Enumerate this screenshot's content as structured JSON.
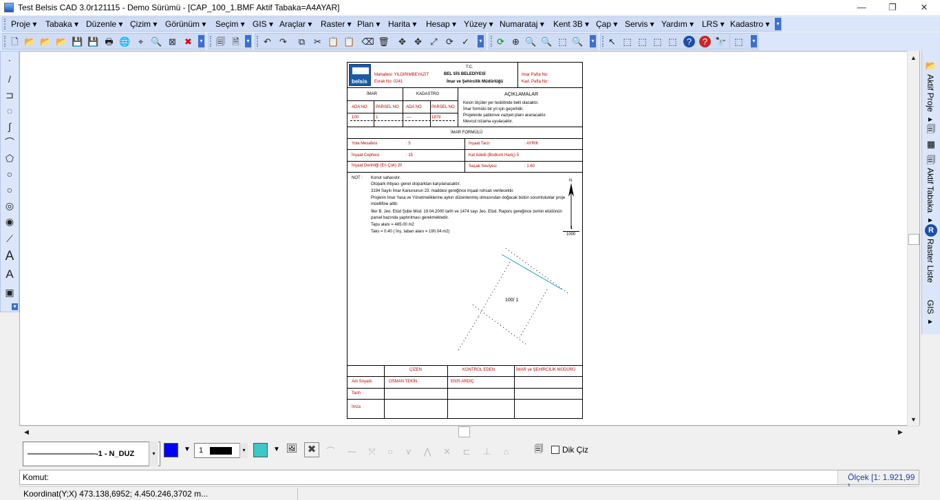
{
  "window": {
    "title": "Test Belsis CAD 3.0r121115 - Demo Sürümü - [CAP_100_1.BMF  Aktif Tabaka=A4AYAR]",
    "minimize": "—",
    "maximize": "❐",
    "close": "✕"
  },
  "menu": [
    "Proje ▾",
    "Tabaka ▾",
    "Düzenle ▾",
    "Çizim ▾",
    "Görünüm ▾",
    "Seçim ▾",
    "GIS ▾",
    "Araçlar ▾",
    "Raster ▾",
    "Plan ▾",
    "Harita ▾",
    "Hesap ▾",
    "Yüzey ▾",
    "Numarataj ▾",
    "Kent 3B ▾",
    "Çap ▾",
    "Servis ▾",
    "Yardım ▾",
    "LRS ▾",
    "Kadastro ▾"
  ],
  "toolbar_glyphs": [
    "🗋",
    "📂",
    "📂",
    "📂",
    "💾",
    "💾",
    "🖶",
    "🌐",
    "⌖",
    "🔍",
    "⊠",
    "✖",
    "🗐",
    "🗎",
    "↶",
    "↷",
    "⧉",
    "✂",
    "📋",
    "📋",
    "⌫",
    "🗑",
    "✥",
    "✥",
    "⤢",
    "⟳",
    "✓",
    "⟳",
    "⊕",
    "🔍",
    "🔍",
    "⬚",
    "🔍",
    "↖",
    "⬚",
    "⬚",
    "⬚",
    "⬚",
    "?",
    "?",
    "🔭",
    "⬚"
  ],
  "left_tools": [
    "·",
    "/",
    "⊐",
    "◌",
    "∫",
    "⌒",
    "⬠",
    "○",
    "○",
    "◎",
    "◉",
    "⟋",
    "A",
    "A",
    "▣"
  ],
  "right_panel": {
    "aktif_proje": "Aktif Proje ▸",
    "aktif_tabaka": "Aktif Tabaka ▸",
    "raster_liste": "Raster Liste",
    "gis": "GIS ▸"
  },
  "bottom": {
    "linetype": "—————————-1 - N_DUZ",
    "lineweight": "1",
    "color": "#0000ff",
    "fill": "#3cc8c8",
    "dik_ciz": "Dik Çiz"
  },
  "command": {
    "label": "Komut:",
    "value": ""
  },
  "scale": "Ölçek [1: 1.921,99 ]",
  "coords": "Koordinat(Y;X)  473.138,6952; 4.450.246,3702 m...",
  "doc": {
    "logo": "belsis",
    "mahallesi": "Mahallesi:  YILDIRIMBEYAZIT",
    "evrak": "Evrak No:  0241",
    "tc": "T.C.",
    "belediye": "BEL SİS BELEDİYESİ",
    "mudurluk": "İmar ve Şehircilik Müdürlüğü",
    "imar_pafta": "İmar Pafta No:",
    "kad_pafta": "Kad. Pafta No:",
    "imar": "İMAR",
    "kadastro": "KADASTRO",
    "aciklamalar": "AÇIKLAMALAR",
    "ada_no": "ADA NO",
    "parsel_no": "PARSEL NO",
    "v_ada": "100",
    "v_parsel": "1",
    "v_kada": "----",
    "v_kparsel": "1879",
    "aciklama": [
      "Kesin ölçüler yer tesbitinde belli olacaktır.",
      "İmar formülü bir yıl için geçerlidir.",
      "Projelerde şablonve vaziyet planı aranacaktır.",
      "Mevcut nizama uyulacaktır."
    ],
    "imar_formulu": "İMAR FORMÜLÜ",
    "yola": "Yola Mesafesi",
    "yola_v": ": 5",
    "insaat_tarzi": "İnşaat Tarzı",
    "insaat_tarzi_v": ": AYRIK",
    "cephe": "İnşaat Cephesi",
    "cephe_v": ": 15",
    "kat": "Kat Adedi (Bodrum Hariç) 5",
    "derinlik": "İnşaat Derinliği (En Çok) 20",
    "sacak": "Saçak Seviyesi",
    "sacak_v": ": 1.60",
    "not_label": "NOT :",
    "notes": [
      "Konut sahasıdır.",
      "Otopark ihtiyacı genel otoparktan karşılanacaktır.",
      "3194 Sayılı İmar Kanununun 23. maddesi gereğince inşaat ruhsatı verilecektir.",
      "Projenin İmar Yasa ve Yönetmeliklerine aykırı düzenlenmiş olmasından doğacak bütün sorumluluklar proje müellifine aittir.",
      "İller B. Jeo. Etüd Şube Müd. 19.04.2000 tarih ve 1474 sayı Jeo. Etüd. Raporu gereğince zemin etüdünün parsel bazında yaptırılması gerekmektedir.",
      "Tapu alanı = 485.00 m2",
      "Taks = 0.40 ( İnş. taban alanı = 190.04 m2)"
    ],
    "north": "N",
    "scale_num": "1",
    "scale_den": "1000",
    "parcel": "100/ 1",
    "cizen": "ÇİZEN",
    "kontrol": "KONTROL EDEN",
    "imar_mudur": "İMAR ve ŞEHİRCİLİK MÜDÜRÜ",
    "adi": "Adı Soyadı",
    "cizen_ad": "OSMAN TEKİN",
    "kontrol_ad": "ENİS ARDIÇ",
    "tarih": "Tarih",
    "imza": "İmza"
  }
}
